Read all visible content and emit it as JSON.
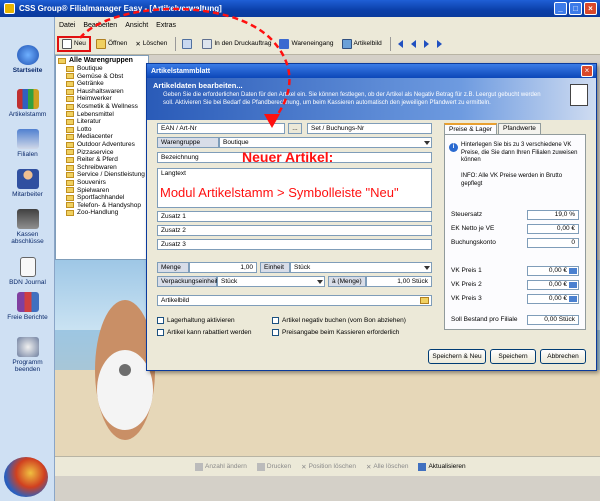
{
  "window": {
    "title": "CSS Group® Filialmanager Easy - [Artikelverwaltung]"
  },
  "sidebar": {
    "items": [
      {
        "label": "Startseite",
        "icon": "globe-icon",
        "active": true
      },
      {
        "label": "Artikelstamm",
        "icon": "books-icon"
      },
      {
        "label": "Filialen",
        "icon": "branch-icon"
      },
      {
        "label": "Mitarbeiter",
        "icon": "person-icon"
      },
      {
        "label": "Kassen abschlüsse",
        "icon": "cash-icon"
      },
      {
        "label": "BDN Journal",
        "icon": "journal-icon"
      },
      {
        "label": "Freie Berichte",
        "icon": "report-icon"
      },
      {
        "label": "Programm beenden",
        "icon": "exit-icon"
      }
    ]
  },
  "menu": {
    "items": [
      "Datei",
      "Bearbeiten",
      "Ansicht",
      "Extras"
    ]
  },
  "toolbar": {
    "new": "Neu",
    "open": "Öffnen",
    "delete": "Löschen",
    "print_order": "In den Druckauftrag",
    "goods_in": "Wareneingang",
    "article_image": "Artikelbild"
  },
  "tree": {
    "root": "Alle Warengruppen",
    "items": [
      "Boutique",
      "Gemüse & Obst",
      "Getränke",
      "Haushaltswaren",
      "Heimwerker",
      "Kosmetik & Wellness",
      "Lebensmittel",
      "Literatur",
      "Lotto",
      "Mediacenter",
      "Outdoor Adventures",
      "Pizzaservice",
      "Reiter & Pferd",
      "Schreibwaren",
      "Service / Dienstleistung",
      "Souvenirs",
      "Spielwaren",
      "Sportfachhandel",
      "Telefon- & Handyshop",
      "Zoo-Handlung"
    ]
  },
  "bottombar": {
    "qty_change": "Anzahl ändern",
    "print": "Drucken",
    "remove_pos": "Position löschen",
    "delete_all": "Alle löschen",
    "refresh": "Aktualisieren"
  },
  "dialog": {
    "window_title": "Artikelstammblatt",
    "header_title": "Artikeldaten bearbeiten...",
    "header_text": "Geben Sie die erforderlichen Daten für den Artikel ein. Sie können festlegen, ob der Artikel als Negativ Betrag für z.B. Leergut gebucht werden soll. Aktivieren Sie bei Bedarf die Pfandberechnung, um beim Kassieren automatisch den jeweiligen Pfandwert zu ermitteln.",
    "ean_placeholder": "EAN / Art-Nr",
    "dots": "...",
    "set_placeholder": "Set / Buchungs-Nr",
    "group_label": "Warengruppe",
    "group_value": "Boutique",
    "name_placeholder": "Bezeichnung",
    "longtext_placeholder": "Langtext",
    "extra1": "Zusatz 1",
    "extra2": "Zusatz 2",
    "extra3": "Zusatz 3",
    "qty_label": "Menge",
    "qty_value": "1,00",
    "unit_label": "Einheit",
    "unit_value": "Stück",
    "pack_label": "Verpackungseinheit",
    "pack_value": "Stück",
    "amount_label": "à (Menge)",
    "amount_value": "1,00 Stück",
    "image_placeholder": "Artikelbild",
    "chk_stock": "Lagerhaltung aktivieren",
    "chk_discount": "Artikel kann rabattiert werden",
    "chk_negative": "Artikel negativ buchen (vom Bon abziehen)",
    "chk_price_req": "Preisangabe beim Kassieren erforderlich",
    "tab_prices": "Preise & Lager",
    "tab_deposit": "Pfandwerte",
    "info1": "Hinterlegen Sie bis zu 3 verschiedene VK Preise, die Sie dann Ihren Filialen zuweisen können",
    "info2": "INFO: Alle VK Preise werden in Brutto gepflegt",
    "tax_label": "Steuersatz",
    "tax_value": "19,0 %",
    "ek_label": "EK Netto je VE",
    "ek_value": "0,00 €",
    "account_label": "Buchungskonto",
    "account_value": "0",
    "vk1_label": "VK Preis 1",
    "vk1_value": "0,00 €",
    "vk2_label": "VK Preis 2",
    "vk2_value": "0,00 €",
    "vk3_label": "VK Preis 3",
    "vk3_value": "0,00 €",
    "stock_label": "Soll Bestand pro Filiale",
    "stock_value": "0,00 Stück",
    "btn_save_new": "Speichern & Neu",
    "btn_save": "Speichern",
    "btn_cancel": "Abbrechen"
  },
  "annotation": {
    "title": "Neuer Artikel:",
    "subtitle": "Modul Artikelstamm > Symbolleiste \"Neu\"",
    "color": "#ff1010"
  }
}
